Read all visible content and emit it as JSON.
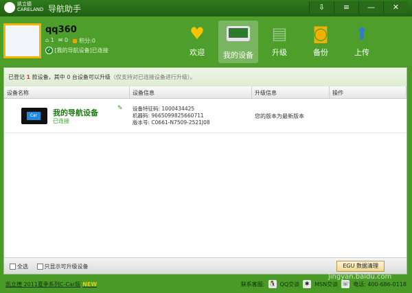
{
  "title": {
    "brand_cn": "凯立德",
    "brand_en": "CARELAND",
    "app": "导航助手"
  },
  "window_buttons": [
    "⇩",
    "≡",
    "—",
    "✕"
  ],
  "user": {
    "name": "qq360",
    "home": "1",
    "mail": "0",
    "points_label": "积分:0",
    "connected": "[我的导航设备]已连接"
  },
  "nav": [
    {
      "label": "欢迎",
      "icon": "heart-icon"
    },
    {
      "label": "我的设备",
      "icon": "gps-device-icon",
      "active": true
    },
    {
      "label": "升级",
      "icon": "upgrade-icon"
    },
    {
      "label": "备份",
      "icon": "backup-icon"
    },
    {
      "label": "上传",
      "icon": "upload-globe-icon"
    }
  ],
  "notice": {
    "pre": "已登记",
    "count": "1",
    "mid": "款设备，其中 0 台设备可以升级",
    "note": "（仅支持对已连接设备进行升级）。"
  },
  "table": {
    "headers": [
      "设备名称",
      "设备信息",
      "升级信息",
      "操作"
    ],
    "rows": [
      {
        "name": "我的导航设备",
        "status": "已连接",
        "screen": "Car",
        "info": [
          "设备特征码: 1000434425",
          "机器码: 9665099825660711",
          "版本号: C0661-N7509-2521J08"
        ],
        "upgrade": "您的版本为最新版本",
        "action": ""
      }
    ]
  },
  "bottom": {
    "select_all": "全选",
    "only_upgradable": "只显示可升级设备",
    "clean_button": "EGU 数据清理"
  },
  "footer": {
    "version": "凯立德 2011夏季系列C-Car版",
    "new_badge": "NEW",
    "contact_label": "联系客服:",
    "qq": "QQ交谈",
    "msn": "MSN交谈",
    "phone": "电话: 400-686-0118"
  },
  "watermark": "jingyan.baidu.com"
}
